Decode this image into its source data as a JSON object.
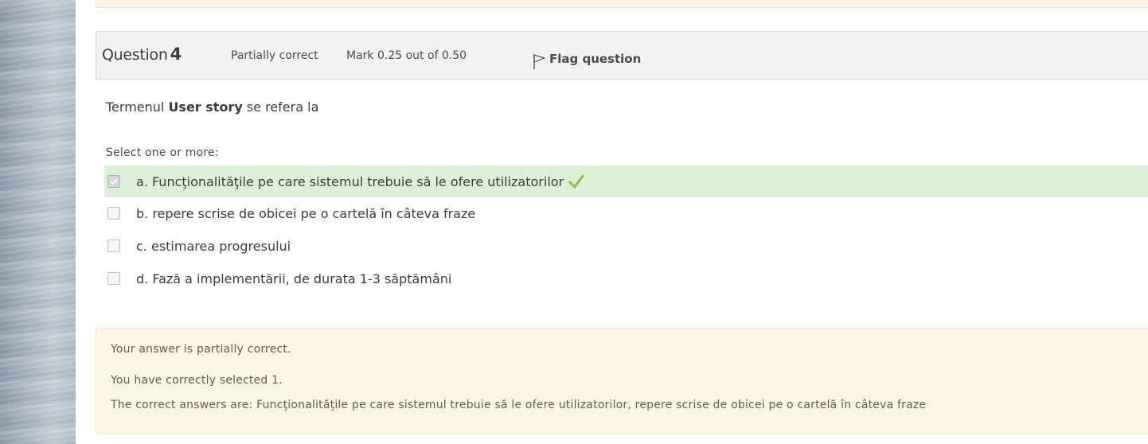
{
  "question": {
    "title_word": "Question",
    "number": "4",
    "state": "Partially correct",
    "grade": "Mark 0.25 out of 0.50",
    "flag_label": "Flag question",
    "text_prefix": "Termenul ",
    "text_bold": "User story",
    "text_suffix": " se refera la",
    "prompt": "Select one or more:"
  },
  "answers": [
    {
      "label": "a. Funcţionalităţile pe care sistemul trebuie să le ofere utilizatorilor",
      "checked": true,
      "correct": true
    },
    {
      "label": "b. repere scrise de obicei pe o cartelă în câteva fraze",
      "checked": false,
      "correct": false
    },
    {
      "label": "c. estimarea progresului",
      "checked": false,
      "correct": false
    },
    {
      "label": "d. Fază a implementării, de durata 1-3 săptămâni",
      "checked": false,
      "correct": false
    }
  ],
  "feedback": {
    "summary": "Your answer is partially correct.",
    "selected": "You have correctly selected 1.",
    "correct_answers": "The correct answers are: Funcţionalităţile pe care sistemul trebuie să le ofere utilizatorilor, repere scrise de obicei pe o cartelă în câteva fraze"
  },
  "colors": {
    "correct_bg": "#dff0d8",
    "feedback_bg": "#fcf6e4",
    "tick": "#8bc34a",
    "header_bg": "#f2f2f2"
  }
}
